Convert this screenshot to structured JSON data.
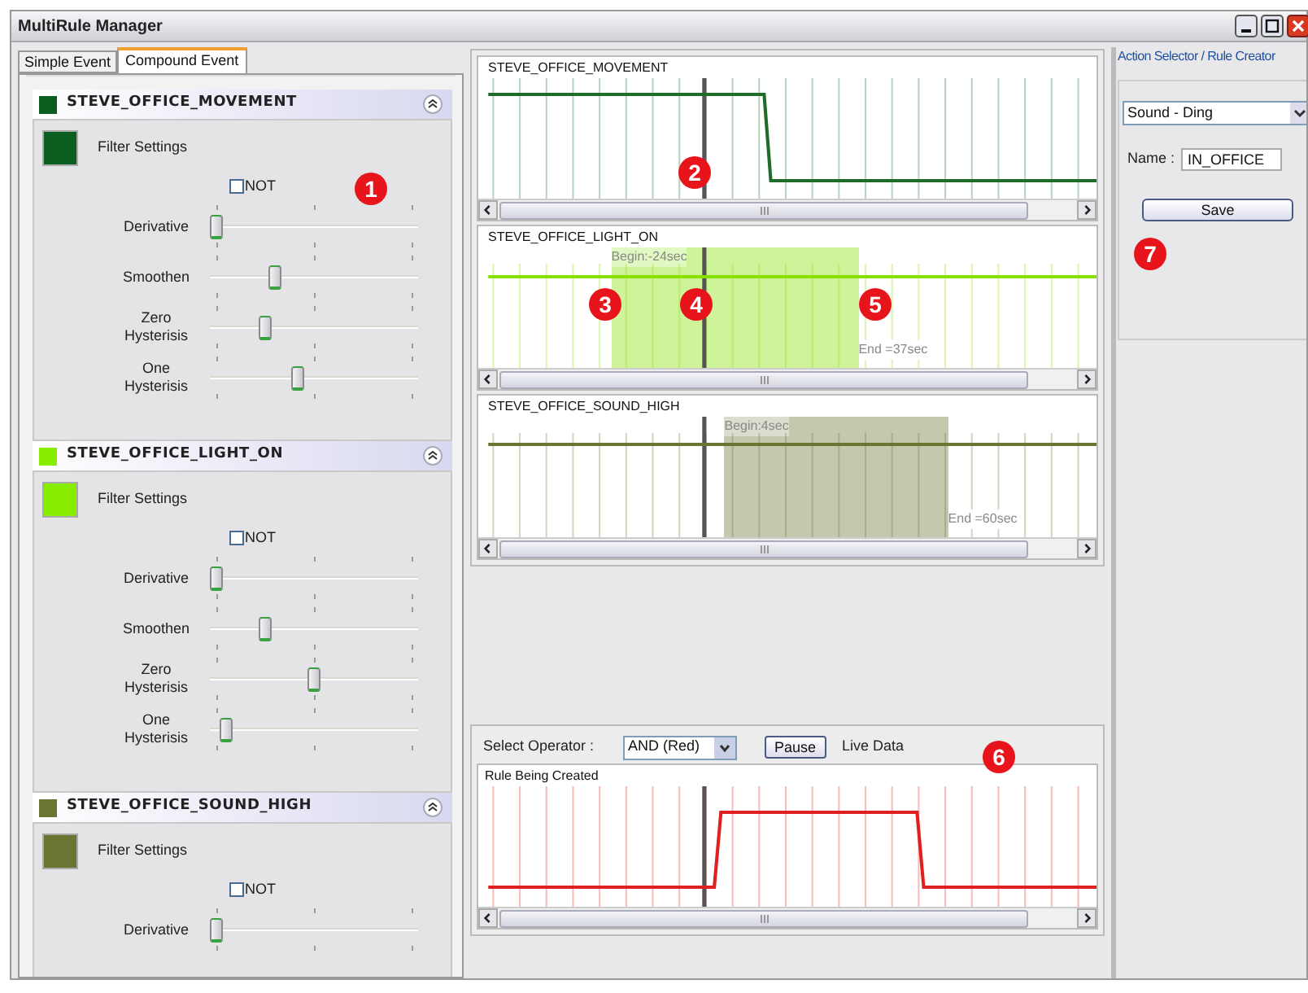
{
  "window": {
    "title": "MultiRule Manager"
  },
  "tabs": [
    {
      "label": "Simple Event",
      "selected": false
    },
    {
      "label": "Compound Event",
      "selected": true
    }
  ],
  "events": [
    {
      "name": "STEVE_OFFICE_MOVEMENT",
      "color": "#0b5e1f",
      "filter_label": "Filter Settings",
      "not_label": "NOT",
      "not_checked": false,
      "sliders": [
        {
          "label": "Derivative",
          "level": 0
        },
        {
          "label": "Smoothen",
          "level": 0.3
        },
        {
          "label": "Zero Hysterisis",
          "level": 0.25
        },
        {
          "label": "One Hysterisis",
          "level": 0.42
        }
      ]
    },
    {
      "name": "STEVE_OFFICE_LIGHT_ON",
      "color": "#88ee00",
      "filter_label": "Filter Settings",
      "not_label": "NOT",
      "not_checked": false,
      "sliders": [
        {
          "label": "Derivative",
          "level": 0
        },
        {
          "label": "Smoothen",
          "level": 0.25
        },
        {
          "label": "Zero Hysterisis",
          "level": 0.5
        },
        {
          "label": "One Hysterisis",
          "level": 0.05
        }
      ]
    },
    {
      "name": "STEVE_OFFICE_SOUND_HIGH",
      "color": "#6b7532",
      "filter_label": "Filter Settings",
      "not_label": "NOT",
      "not_checked": false,
      "sliders": [
        {
          "label": "Derivative",
          "level": 0
        }
      ]
    }
  ],
  "signals": [
    {
      "name": "STEVE_OFFICE_MOVEMENT",
      "color": "#1e6b2a",
      "kind": "step_down"
    },
    {
      "name": "STEVE_OFFICE_LIGHT_ON",
      "color": "#88e000",
      "kind": "flat",
      "window": {
        "begin": "Begin:-24sec",
        "end": "End =37sec"
      }
    },
    {
      "name": "STEVE_OFFICE_SOUND_HIGH",
      "color": "#6b7532",
      "kind": "flat",
      "window": {
        "begin": "Begin:4sec",
        "end": "End =60sec"
      }
    }
  ],
  "operator": {
    "label": "Select Operator :",
    "value": "AND (Red)",
    "pause": "Pause",
    "status": "Live Data"
  },
  "rule": {
    "name": "Rule Being Created",
    "color": "#e02020",
    "kind": "pulse"
  },
  "action": {
    "title": "Action Selector / Rule Creator",
    "action": "Sound - Ding",
    "name_label": "Name :",
    "name_value": "IN_OFFICE",
    "save": "Save"
  },
  "callouts": [
    "1",
    "2",
    "3",
    "4",
    "5",
    "6",
    "7"
  ]
}
